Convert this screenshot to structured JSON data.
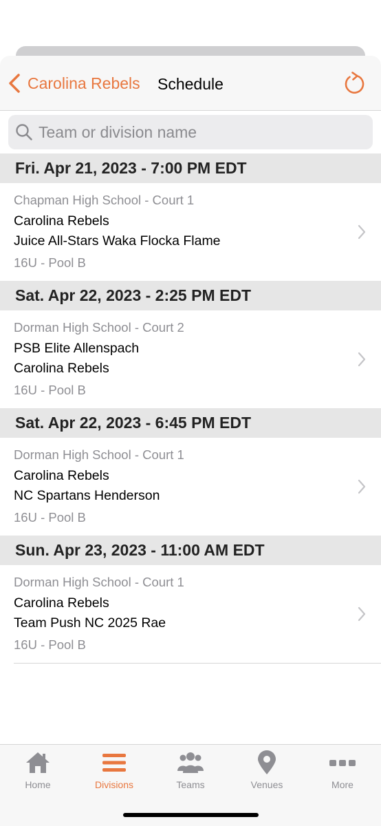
{
  "nav": {
    "back_label": "Carolina Rebels",
    "title": "Schedule"
  },
  "search": {
    "placeholder": "Team or division name",
    "value": ""
  },
  "days": [
    {
      "header": "Fri. Apr 21, 2023 - 7:00 PM EDT",
      "game": {
        "venue": "Chapman High School - Court 1",
        "team1": "Carolina Rebels",
        "team2": "Juice All-Stars Waka Flocka Flame",
        "division": "16U - Pool B"
      }
    },
    {
      "header": "Sat. Apr 22, 2023 - 2:25 PM EDT",
      "game": {
        "venue": "Dorman High School - Court 2",
        "team1": "PSB Elite Allenspach",
        "team2": "Carolina Rebels",
        "division": "16U - Pool B"
      }
    },
    {
      "header": "Sat. Apr 22, 2023 - 6:45 PM EDT",
      "game": {
        "venue": "Dorman High School - Court 1",
        "team1": "Carolina Rebels",
        "team2": "NC Spartans Henderson",
        "division": "16U - Pool B"
      }
    },
    {
      "header": "Sun. Apr 23, 2023 - 11:00 AM EDT",
      "game": {
        "venue": "Dorman High School - Court 1",
        "team1": "Carolina Rebels",
        "team2": "Team Push NC 2025 Rae",
        "division": "16U - Pool B"
      }
    }
  ],
  "tabs": [
    {
      "label": "Home",
      "icon": "home-icon"
    },
    {
      "label": "Divisions",
      "icon": "menu-icon",
      "active": true
    },
    {
      "label": "Teams",
      "icon": "people-icon"
    },
    {
      "label": "Venues",
      "icon": "map-pin-icon"
    },
    {
      "label": "More",
      "icon": "ellipsis-icon"
    }
  ],
  "colors": {
    "accent": "#e8773f",
    "inactive": "#8e8e93",
    "header_bg": "#e6e6e6"
  }
}
